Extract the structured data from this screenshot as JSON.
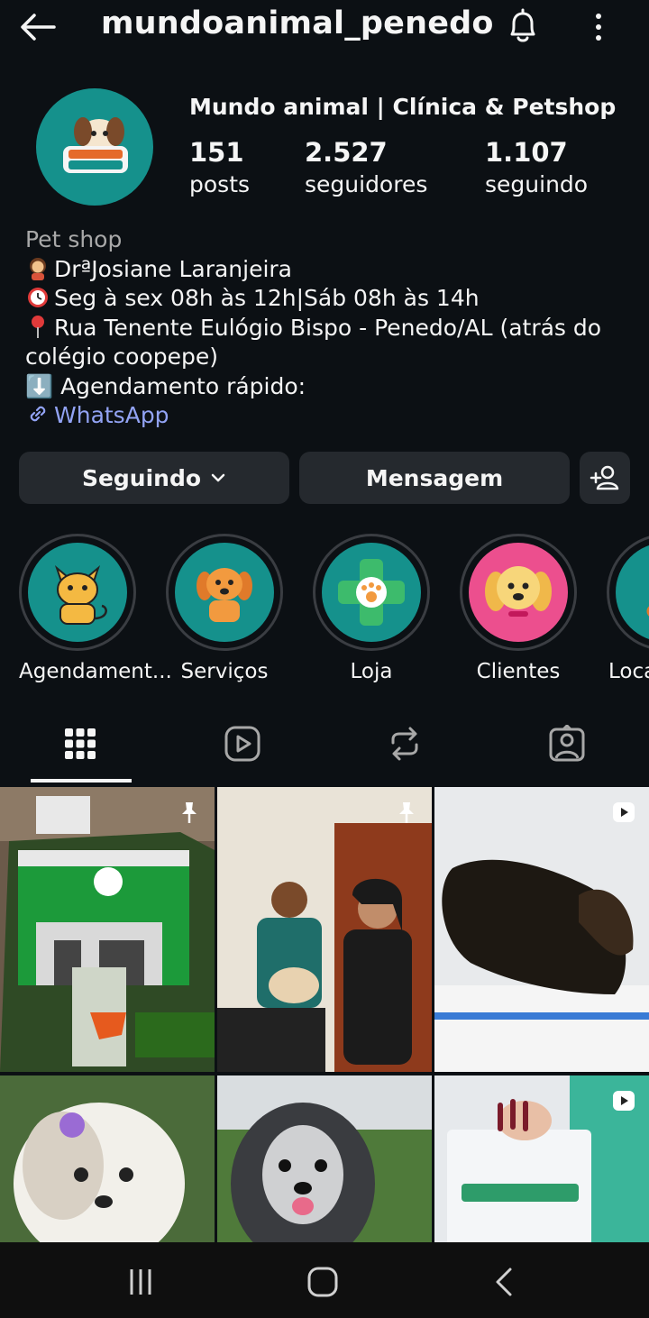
{
  "header": {
    "username": "mundoanimal_penedo"
  },
  "profile": {
    "display_name": "Mundo animal | Clínica & Petshop",
    "stats": [
      {
        "value": "151",
        "label": "posts"
      },
      {
        "value": "2.527",
        "label": "seguidores"
      },
      {
        "value": "1.107",
        "label": "seguindo"
      }
    ],
    "category": "Pet shop",
    "bio_lines": [
      "DrªJosiane Laranjeira",
      "Seg à sex 08h às 12h|Sáb 08h às 14h",
      "Rua Tenente Eulógio Bispo - Penedo/AL (atrás do",
      "colégio coopepe)",
      "⬇️ Agendamento rápido:"
    ],
    "link_text": "WhatsApp"
  },
  "actions": {
    "following_label": "Seguindo",
    "message_label": "Mensagem"
  },
  "highlights": [
    {
      "label": "Agendament...",
      "icon": "cat-icon"
    },
    {
      "label": "Serviços",
      "icon": "dog-icon"
    },
    {
      "label": "Loja",
      "icon": "paw-cross-icon"
    },
    {
      "label": "Clientes",
      "icon": "puppy-icon"
    },
    {
      "label": "Loca",
      "icon": "location-icon"
    }
  ],
  "tabs": [
    "grid-icon",
    "reels-icon",
    "reposts-icon",
    "tagged-icon"
  ],
  "colors": {
    "background": "#0c1014",
    "button": "#25292e",
    "teal": "#15918c",
    "link": "#92a3f4",
    "muted": "#a8a8a8"
  }
}
